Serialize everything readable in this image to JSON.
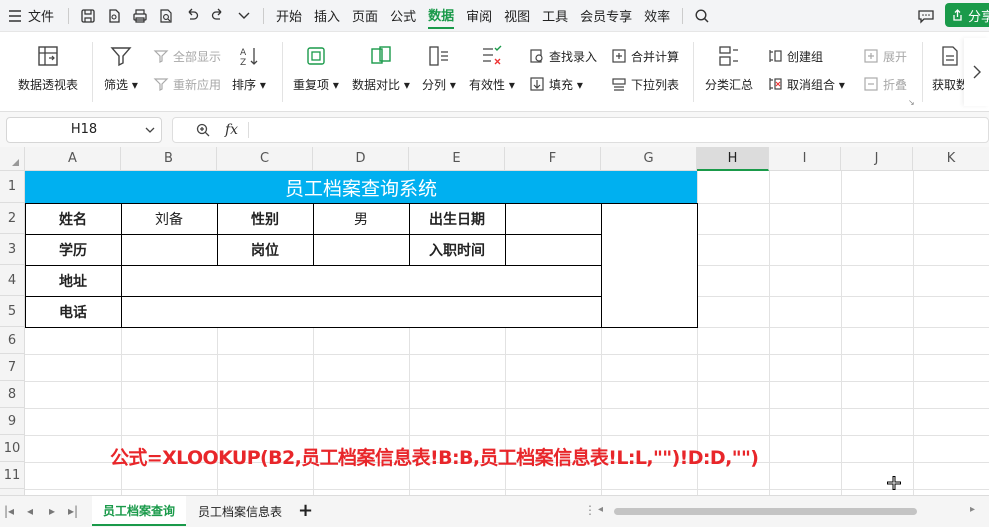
{
  "menubar": {
    "file_label": "文件",
    "tabs": [
      "开始",
      "插入",
      "页面",
      "公式",
      "数据",
      "审阅",
      "视图",
      "工具",
      "会员专享",
      "效率"
    ],
    "active_tab": "数据",
    "share_label": "分享"
  },
  "ribbon": {
    "pivot": "数据透视表",
    "filter": "筛选",
    "show_all": "全部显示",
    "reapply": "重新应用",
    "sort": "排序",
    "duplicates": "重复项",
    "compare": "数据对比",
    "split": "分列",
    "validity": "有效性",
    "find_entry": "查找录入",
    "fill": "填充",
    "merge_calc": "合并计算",
    "dropdown_list": "下拉列表",
    "subtotal": "分类汇总",
    "create_group": "创建组",
    "ungroup": "取消组合",
    "expand": "展开",
    "collapse": "折叠",
    "get_data": "获取数"
  },
  "formula_bar": {
    "cell_ref": "H18",
    "fx_label": "fx",
    "content": ""
  },
  "sheet": {
    "columns": [
      "A",
      "B",
      "C",
      "D",
      "E",
      "F",
      "G",
      "H",
      "I",
      "J",
      "K"
    ],
    "selected_column": "H",
    "rows": [
      "1",
      "2",
      "3",
      "4",
      "5",
      "6",
      "7",
      "8",
      "9",
      "10",
      "11"
    ],
    "title": "员工档案查询系统",
    "cells": {
      "name_label": "姓名",
      "name_value": "刘备",
      "gender_label": "性别",
      "gender_value": "男",
      "birth_label": "出生日期",
      "education_label": "学历",
      "position_label": "岗位",
      "hire_label": "入职时间",
      "address_label": "地址",
      "phone_label": "电话"
    },
    "formula_annotation": "公式=XLOOKUP(B2,员工档案信息表!B:B,员工档案信息表!L:L,\"\")!D:D,\"\")",
    "title_bg": "#00b0f0",
    "annotation_color": "#e8262a"
  },
  "sheet_tabs": {
    "tabs": [
      "员工档案查询",
      "员工档案信息表"
    ],
    "active": "员工档案查询"
  },
  "colors": {
    "accent": "#1a9a4a",
    "menubar_bg": "#f3f4f6"
  }
}
